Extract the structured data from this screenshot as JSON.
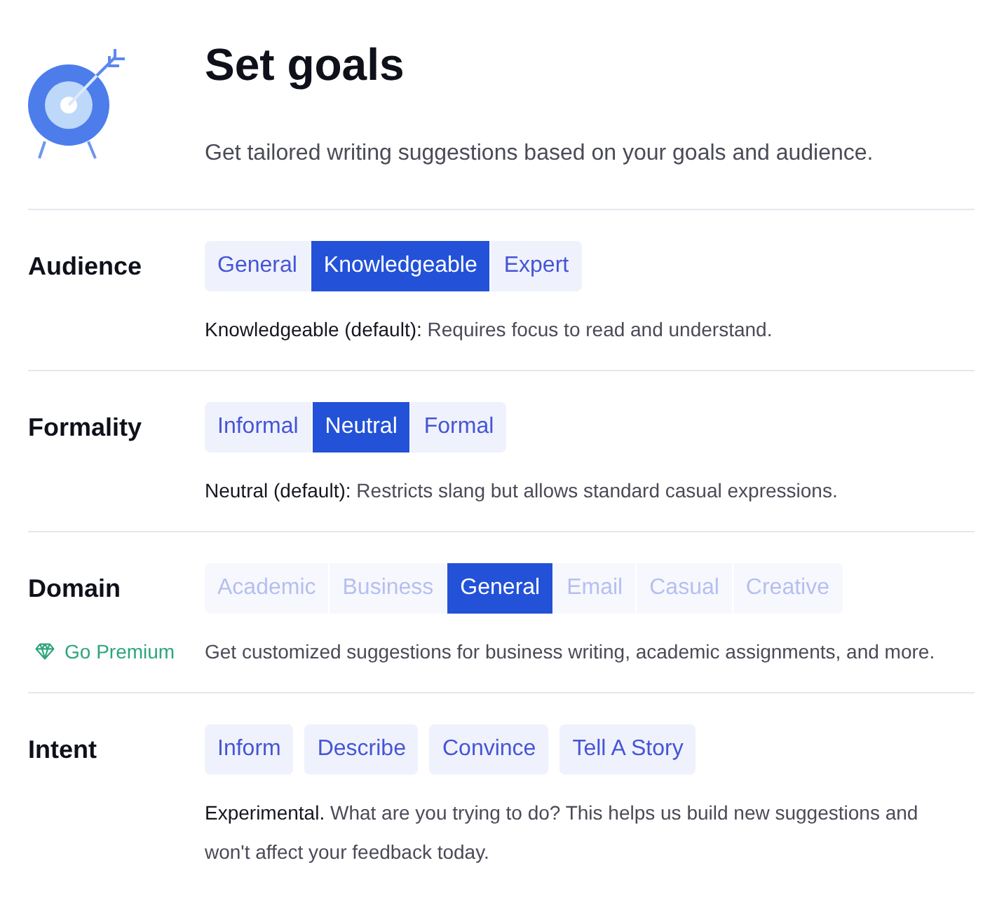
{
  "header": {
    "title": "Set goals",
    "subtitle": "Get tailored writing suggestions based on your goals and audience."
  },
  "groups": [
    {
      "label": "Audience",
      "kind": "segmented",
      "options": [
        {
          "label": "General",
          "selected": false
        },
        {
          "label": "Knowledgeable",
          "selected": true
        },
        {
          "label": "Expert",
          "selected": false
        }
      ],
      "description": {
        "lead": "Knowledgeable (default):",
        "text": "Requires focus to read and understand."
      }
    },
    {
      "label": "Formality",
      "kind": "segmented",
      "options": [
        {
          "label": "Informal",
          "selected": false
        },
        {
          "label": "Neutral",
          "selected": true
        },
        {
          "label": "Formal",
          "selected": false
        }
      ],
      "description": {
        "lead": "Neutral (default):",
        "text": "Restricts slang but allows standard casual expressions."
      }
    },
    {
      "label": "Domain",
      "kind": "segmented",
      "options": [
        {
          "label": "Academic",
          "selected": false,
          "disabled": true
        },
        {
          "label": "Business",
          "selected": false,
          "disabled": true
        },
        {
          "label": "General",
          "selected": true,
          "disabled": false
        },
        {
          "label": "Email",
          "selected": false,
          "disabled": true
        },
        {
          "label": "Casual",
          "selected": false,
          "disabled": true
        },
        {
          "label": "Creative",
          "selected": false,
          "disabled": true
        }
      ],
      "premium_link": "Go Premium",
      "description": {
        "text": "Get customized suggestions for business writing, academic assignments, and more."
      }
    },
    {
      "label": "Intent",
      "kind": "chips",
      "options": [
        {
          "label": "Inform",
          "selected": false
        },
        {
          "label": "Describe",
          "selected": false
        },
        {
          "label": "Convince",
          "selected": false
        },
        {
          "label": "Tell A Story",
          "selected": false
        }
      ],
      "description": {
        "lead": "Experimental.",
        "text": "What are you trying to do? This helps us build new suggestions and won't affect your feedback today."
      }
    }
  ]
}
